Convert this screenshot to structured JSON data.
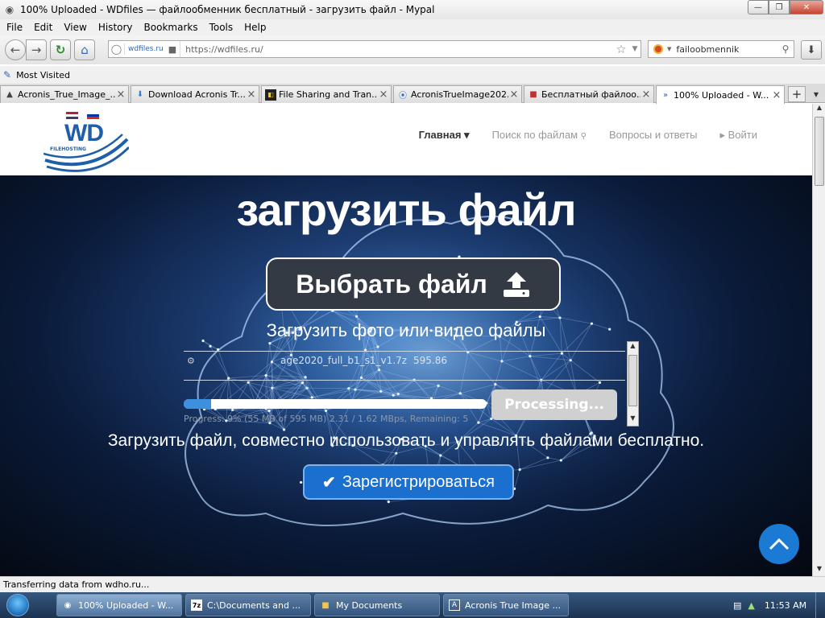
{
  "window": {
    "title": "100% Uploaded - WDfiles — файлообменник бесплатный - загрузить файл - Mypal",
    "min_icon": "minimize-icon",
    "max_icon": "maximize-icon",
    "close_icon": "close-icon"
  },
  "menu": [
    "File",
    "Edit",
    "View",
    "History",
    "Bookmarks",
    "Tools",
    "Help"
  ],
  "toolbar": {
    "site_badge": "wdfiles.ru",
    "url": "https://wdfiles.ru/",
    "search_value": "failoobmennik"
  },
  "bookmarks": {
    "most_visited": "Most Visited"
  },
  "tabs": [
    {
      "label": "Acronis_True_Image_...",
      "icon": "acronis-icon"
    },
    {
      "label": "Download Acronis Tr...",
      "icon": "download-icon"
    },
    {
      "label": "File Sharing and Tran...",
      "icon": "fileshare-icon"
    },
    {
      "label": "AcronisTrueImage202...",
      "icon": "acronis-blue-icon"
    },
    {
      "label": "Бесплатный файлоо...",
      "icon": "box-icon"
    },
    {
      "label": "100% Uploaded - W...",
      "icon": "wd-icon",
      "active": true
    }
  ],
  "site": {
    "logo_text": "WD",
    "logo_sub": "FILEHOSTING",
    "nav": [
      {
        "label": "Главная ▾"
      },
      {
        "label": "Поиск по файлам"
      },
      {
        "label": "Вопросы и ответы"
      },
      {
        "label": "▸ Войти"
      }
    ]
  },
  "hero": {
    "title": "загрузить файл",
    "choose_button": "Выбрать файл",
    "subtitle": "Загрузить фото или видео файлы",
    "tagline": "Загрузить файл, совместно использовать и управлять файлами бесплатно.",
    "register_button": "Зарегистрироваться"
  },
  "upload": {
    "file_name": "age2020_full_b1_s1_v1.7z",
    "file_size": "595.86",
    "progress": 0.09,
    "processing_button": "Processing...",
    "progress_info": "Progress: 9% (55 MB of 595 MB)       2.31 / 1.62 MBps, Remaining: 5"
  },
  "status": {
    "text": "Transferring data from wdho.ru..."
  },
  "taskbar": {
    "items": [
      {
        "label": "100% Uploaded - W...",
        "icon": "browser-icon",
        "active": true
      },
      {
        "label": "C:\\Documents and ...",
        "icon": "7zip-icon"
      },
      {
        "label": "My Documents",
        "icon": "folder-icon"
      },
      {
        "label": "Acronis True Image ...",
        "icon": "acronis-icon"
      }
    ],
    "clock": "11:53 AM"
  },
  "colors": {
    "accent": "#1a6fcf",
    "hero_bg": "#0a1a38",
    "totop": "#1a7ad4"
  }
}
